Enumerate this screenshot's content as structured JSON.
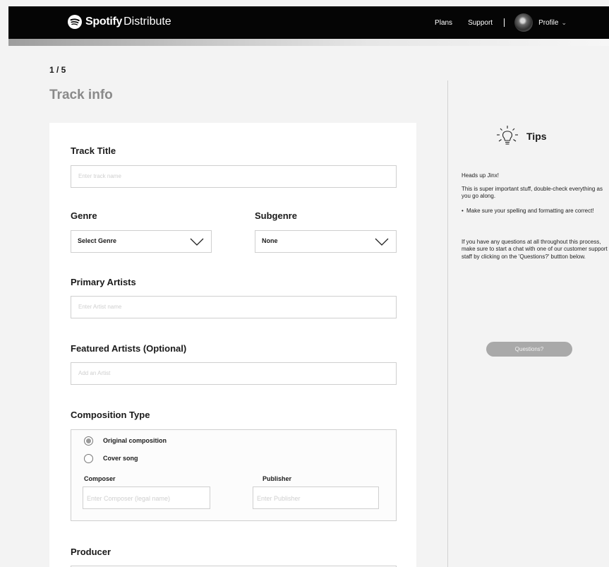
{
  "header": {
    "logo_main": "Spotify",
    "logo_sub": "Distribute",
    "nav": {
      "plans": "Plans",
      "support": "Support",
      "profile": "Profile"
    }
  },
  "progress": {
    "fraction": 0.2
  },
  "step": "1 / 5",
  "page_title": "Track info",
  "form": {
    "track_title": {
      "label": "Track Title",
      "placeholder": "Enter track name"
    },
    "genre": {
      "label": "Genre",
      "value": "Select Genre"
    },
    "subgenre": {
      "label": "Subgenre",
      "value": "None"
    },
    "primary_artists": {
      "label": "Primary Artists",
      "placeholder": "Enter Artist name"
    },
    "featured_artists": {
      "label": "Featured Artists (Optional)",
      "placeholder": "Add an Artist"
    },
    "composition_type": {
      "label": "Composition Type",
      "options": [
        {
          "label": "Original composition",
          "selected": true
        },
        {
          "label": "Cover song",
          "selected": false
        }
      ],
      "composer": {
        "label": "Composer",
        "placeholder": "Enter Composer (legal name)"
      },
      "publisher": {
        "label": "Publisher",
        "placeholder": "Enter Publisher"
      }
    },
    "producer": {
      "label": "Producer"
    }
  },
  "tips": {
    "title": "Tips",
    "greeting": "Heads up Jinx!",
    "para1": "This is super important stuff, double-check everything as you go along.",
    "bullet": "Make sure your spelling and formatting are correct!",
    "para2": "If you have any questions at all throughout this process, make sure to start a chat with one of our customer support staff by clicking on the 'Questions?' buttton below.",
    "button": "Questions?"
  },
  "icons": {
    "logo": "spotify-logo-icon",
    "tips": "lightbulb-icon",
    "dropdown": "chevron-down-icon",
    "avatar": "profile-avatar"
  }
}
